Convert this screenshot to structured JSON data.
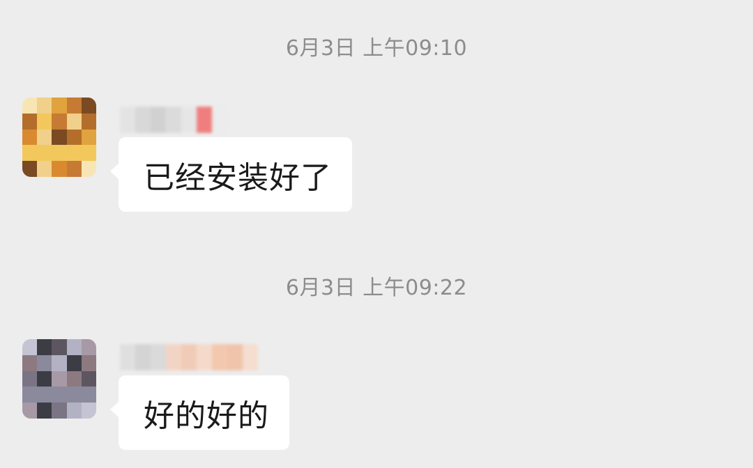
{
  "messages": [
    {
      "timestamp": "6月3日 上午09:10",
      "text": "已经安装好了",
      "sender": {
        "avatar_icon": "pixelated-avatar",
        "nickname_redacted": true,
        "avatar_colors": [
          "#f7e6b4",
          "#f2c85c",
          "#e0a33e",
          "#b46e2c",
          "#7a4a22",
          "#f0d08a",
          "#d98a30",
          "#c77a33"
        ],
        "nickname_colors": [
          "#e3e3e3",
          "#d6d6d6",
          "#cfcfcf",
          "#dadada",
          "#e6e6e6",
          "#f07474",
          "#ececec"
        ]
      }
    },
    {
      "timestamp": "6月3日 上午09:22",
      "text": "好的好的",
      "sender": {
        "avatar_icon": "pixelated-avatar",
        "nickname_redacted": true,
        "avatar_colors": [
          "#c4c4d4",
          "#8a8a9c",
          "#5d5660",
          "#8c7a80",
          "#a79aa6",
          "#3c3c44",
          "#7b7484",
          "#b2b2c4"
        ],
        "nickname_colors": [
          "#dedede",
          "#d2d2d2",
          "#d8d8d8",
          "#f4d2c0",
          "#f1c8b2",
          "#f6d8c8",
          "#f3c4a8",
          "#f0c0a4",
          "#f6dccc"
        ]
      }
    }
  ],
  "colors": {
    "background": "#ededed",
    "bubble": "#ffffff",
    "timestamp_text": "#8c8c8c",
    "message_text": "#1a1a1a"
  }
}
